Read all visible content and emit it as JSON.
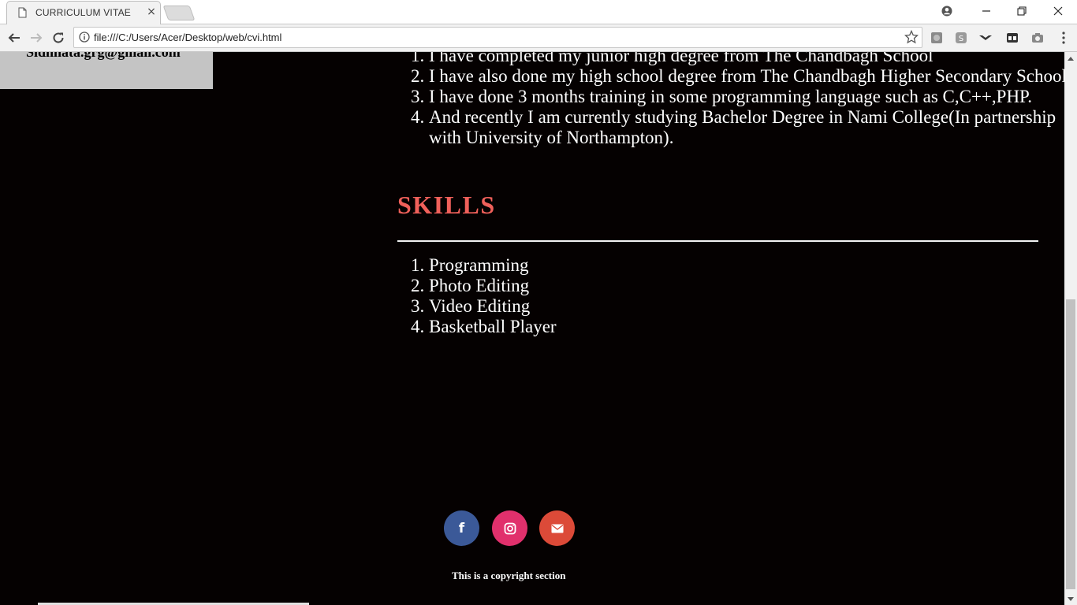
{
  "browser": {
    "tab_title": "CURRICULUM VITAE",
    "tab_close": "×",
    "url": "file:///C:/Users/Acer/Desktop/web/cvi.html",
    "extensions": [
      "extension-icon",
      "skype-icon",
      "extension-icon",
      "extension-icon",
      "camera-icon",
      "menu-icon"
    ]
  },
  "page": {
    "email": "Sidhhata.grg@gmail.com",
    "education": [
      "I have completed my junior high degree from The Chandbagh School",
      "I have also done my high school degree from The Chandbagh Higher Secondary School",
      "I have done 3 months training in some programming language such as C,C++,PHP.",
      "And recently I am currently studying Bachelor Degree in Nami College(In partnership with University of Northampton)."
    ],
    "skills_title": "SKILLS",
    "skills": [
      "Programming",
      "Photo Editing",
      "Video Editing",
      "Basketball Player"
    ],
    "social": {
      "facebook_glyph": "f",
      "facebook_color": "#3b5998",
      "instagram_color": "#e1306c",
      "email_color": "#dc4a38"
    },
    "copyright": "This is a copyright section"
  },
  "colors": {
    "page_bg": "#050101",
    "skills_heading": "#f0605a",
    "contact_box": "#c4c4c4"
  }
}
